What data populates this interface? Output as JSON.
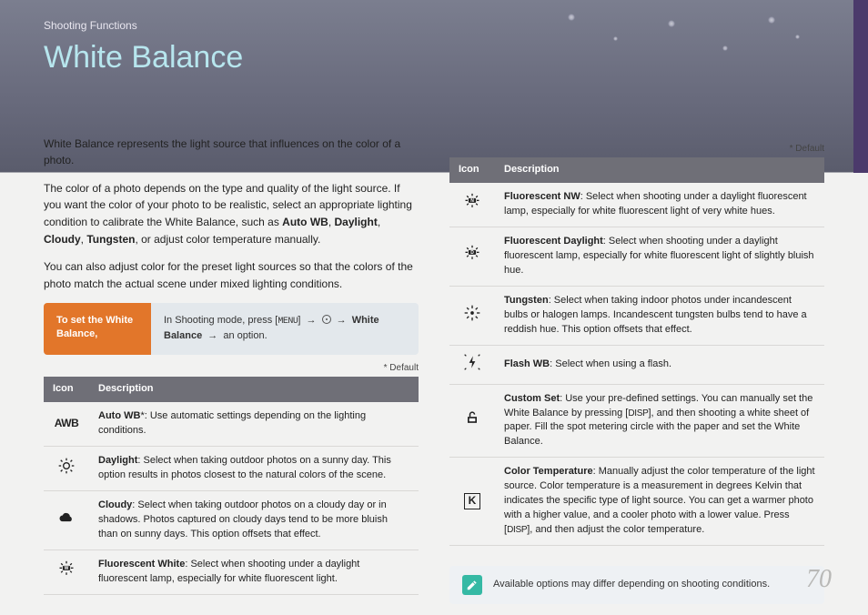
{
  "chapter": "Shooting Functions",
  "title": "White Balance",
  "page_number": "70",
  "intro": {
    "p1": "White Balance represents the light source that influences on the color of a photo.",
    "p2a": "The color of a photo depends on the type and quality of the light source. If you want the color of your photo to be realistic, select an appropriate lighting condition to calibrate the White Balance, such as ",
    "p2_items": [
      "Auto WB",
      "Daylight",
      "Cloudy",
      "Tungsten"
    ],
    "p2b": ", or adjust color temperature manually.",
    "p3": "You can also adjust color for the preset light sources so that the colors of the photo match the actual scene under mixed lighting conditions."
  },
  "setbox": {
    "left": "To set the White Balance,",
    "right_pre": "In Shooting mode, press [",
    "menu": "MENU",
    "right_mid": "] ",
    "wb": "White Balance",
    "right_post": " an option."
  },
  "default_label": "* Default",
  "table_headers": {
    "icon": "Icon",
    "desc": "Description"
  },
  "left_table": [
    {
      "icon_key": "awb",
      "title": "Auto WB",
      "star": "*",
      "body": ": Use automatic settings depending on the lighting conditions."
    },
    {
      "icon_key": "daylight",
      "title": "Daylight",
      "star": "",
      "body": ": Select when taking outdoor photos on a sunny day. This option results in photos closest to the natural colors of the scene."
    },
    {
      "icon_key": "cloudy",
      "title": "Cloudy",
      "star": "",
      "body": ": Select when taking outdoor photos on a cloudy day or in shadows. Photos captured on cloudy days tend to be more bluish than on sunny days. This option offsets that effect."
    },
    {
      "icon_key": "fluo_w",
      "title": "Fluorescent White",
      "star": "",
      "body": ": Select when shooting under a daylight fluorescent lamp, especially for white fluorescent light."
    }
  ],
  "right_table": [
    {
      "icon_key": "fluo_n",
      "title": "Fluorescent NW",
      "star": "",
      "body": ": Select when shooting under a daylight fluorescent lamp, especially for white fluorescent light of very white hues."
    },
    {
      "icon_key": "fluo_d",
      "title": "Fluorescent Daylight",
      "star": "",
      "body": ": Select when shooting under a daylight fluorescent lamp, especially for white fluorescent light of slightly bluish hue."
    },
    {
      "icon_key": "tungsten",
      "title": "Tungsten",
      "star": "",
      "body": ": Select when taking indoor photos under incandescent bulbs or halogen lamps. Incandescent tungsten bulbs tend to have a reddish hue. This option offsets that effect."
    },
    {
      "icon_key": "flash",
      "title": "Flash WB",
      "star": "",
      "body": ": Select when using a flash."
    },
    {
      "icon_key": "custom",
      "title": "Custom Set",
      "star": "",
      "body_pre": ": Use your pre-defined settings. You can manually set the White Balance by pressing [",
      "disp": "DISP",
      "body_post": "], and then shooting a white sheet of paper. Fill the spot metering circle with the paper and set the White Balance."
    },
    {
      "icon_key": "kelvin",
      "title": "Color Temperature",
      "star": "",
      "body_pre": ": Manually adjust the color temperature of the light source. Color temperature is a measurement in degrees Kelvin that indicates the specific type of light source. You can get a warmer photo with a higher value, and a cooler photo with a lower value. Press [",
      "disp": "DISP",
      "body_post": "], and then adjust the color temperature."
    }
  ],
  "note": "Available options may differ depending on shooting conditions.",
  "icons": {
    "awb_text": "AWB",
    "k_text": "K"
  }
}
